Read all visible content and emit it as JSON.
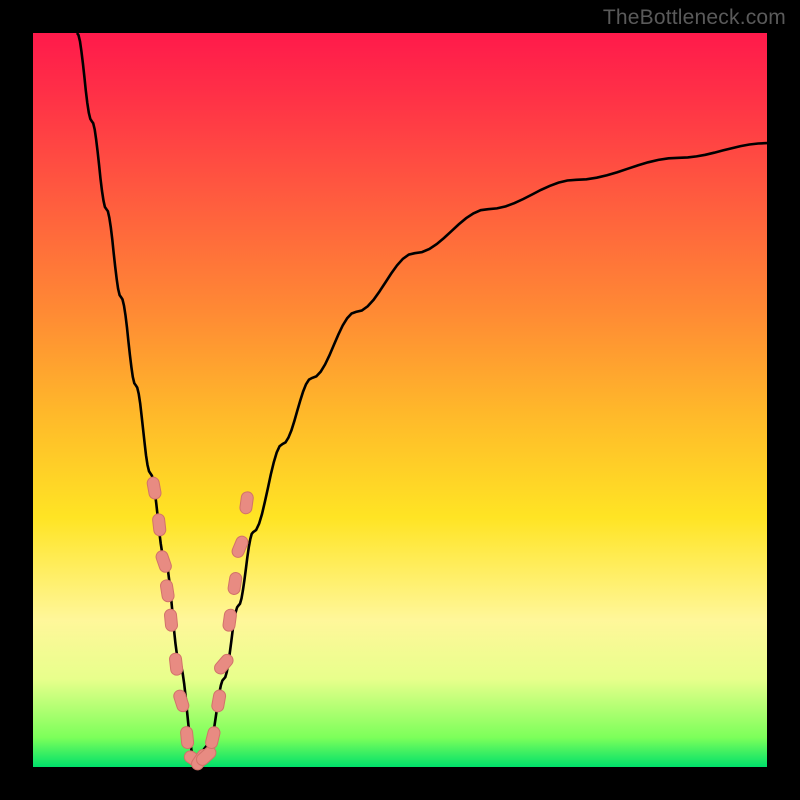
{
  "watermark": "TheBottleneck.com",
  "colors": {
    "frame": "#000000",
    "gradient_top": "#ff1a4b",
    "gradient_bottom": "#00e06a",
    "curve": "#000000",
    "marker_fill": "#e88b82",
    "marker_stroke": "#d2726a"
  },
  "chart_data": {
    "type": "line",
    "title": "",
    "xlabel": "",
    "ylabel": "",
    "xlim": [
      0,
      100
    ],
    "ylim": [
      0,
      100
    ],
    "grid": false,
    "legend": false,
    "note": "Bottleneck-style V-curve. y-axis is inverted visually (0 % at bottom  ≈ no bottleneck / green, 100 % at top ≈ severe bottleneck / red). x ≈ relative component performance. Minimum of the curve sits near x≈22.",
    "series": [
      {
        "name": "bottleneck-curve",
        "x": [
          6,
          8,
          10,
          12,
          14,
          16,
          18,
          20,
          22,
          24,
          26,
          28,
          30,
          34,
          38,
          44,
          52,
          62,
          74,
          88,
          100
        ],
        "y": [
          100,
          88,
          76,
          64,
          52,
          40,
          28,
          14,
          1,
          3,
          12,
          22,
          32,
          44,
          53,
          62,
          70,
          76,
          80,
          83,
          85
        ]
      }
    ],
    "markers": {
      "name": "sample-points",
      "note": "Salmon capsule-shaped markers clustered on both arms of the V near the bottom.",
      "points": [
        {
          "x": 16.5,
          "y": 38
        },
        {
          "x": 17.2,
          "y": 33
        },
        {
          "x": 17.8,
          "y": 28
        },
        {
          "x": 18.3,
          "y": 24
        },
        {
          "x": 18.8,
          "y": 20
        },
        {
          "x": 19.5,
          "y": 14
        },
        {
          "x": 20.2,
          "y": 9
        },
        {
          "x": 21.0,
          "y": 4
        },
        {
          "x": 22.0,
          "y": 1
        },
        {
          "x": 22.8,
          "y": 1
        },
        {
          "x": 23.6,
          "y": 1.5
        },
        {
          "x": 24.5,
          "y": 4
        },
        {
          "x": 25.3,
          "y": 9
        },
        {
          "x": 26.0,
          "y": 14
        },
        {
          "x": 26.8,
          "y": 20
        },
        {
          "x": 27.5,
          "y": 25
        },
        {
          "x": 28.2,
          "y": 30
        },
        {
          "x": 29.1,
          "y": 36
        }
      ]
    }
  }
}
